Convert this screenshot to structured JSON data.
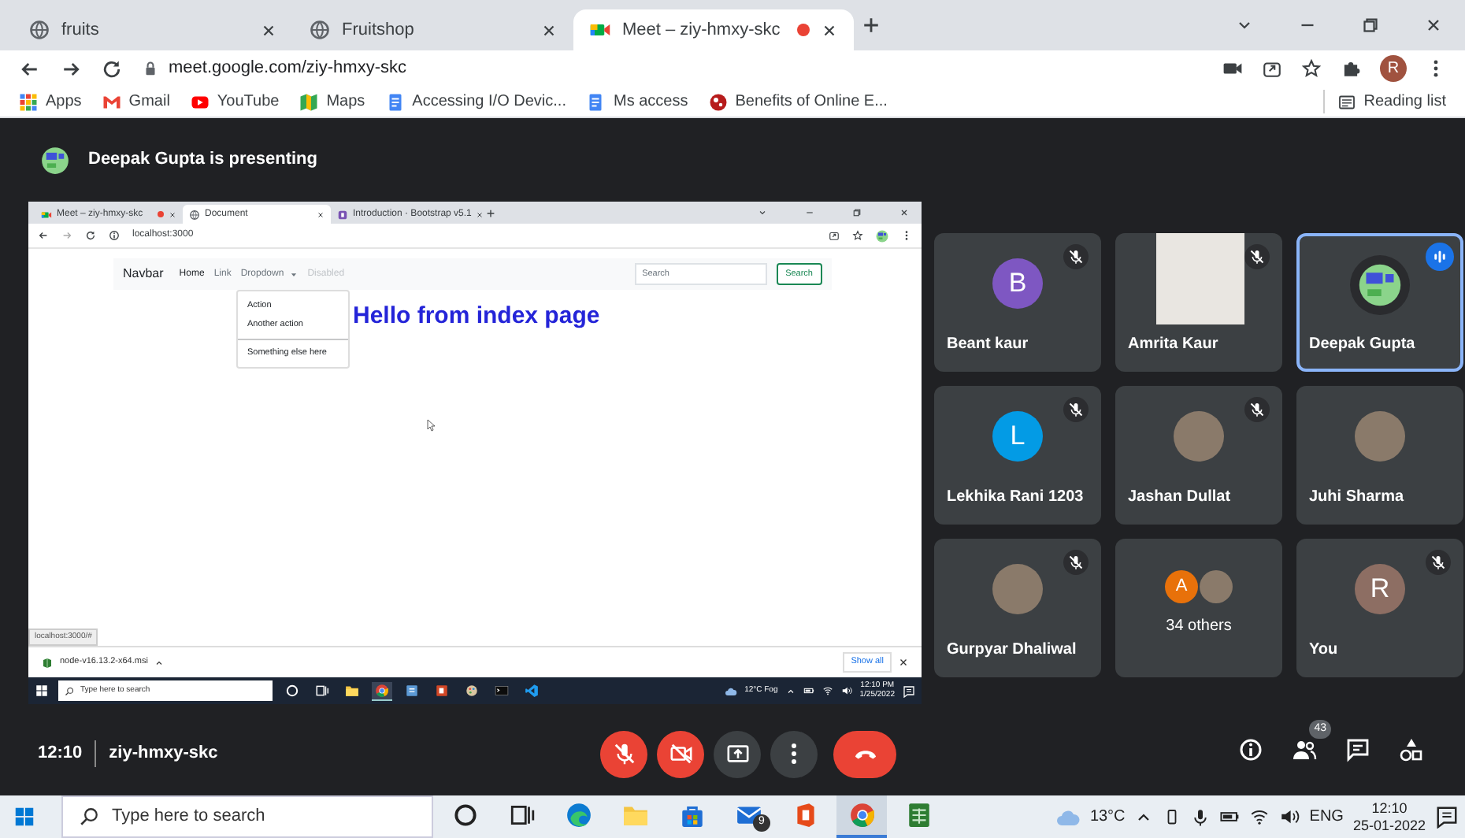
{
  "browser": {
    "tabs": [
      {
        "title": "fruits",
        "kind": "globe",
        "selected": false,
        "recording": false
      },
      {
        "title": "Fruitshop",
        "kind": "globe",
        "selected": false,
        "recording": false
      },
      {
        "title": "Meet – ziy-hmxy-skc",
        "kind": "meet",
        "selected": true,
        "recording": true
      }
    ],
    "address": "meet.google.com/ziy-hmxy-skc",
    "profile_initial": "R",
    "bookmarks": [
      {
        "label": "Apps",
        "kind": "apps"
      },
      {
        "label": "Gmail",
        "kind": "gmail"
      },
      {
        "label": "YouTube",
        "kind": "youtube"
      },
      {
        "label": "Maps",
        "kind": "maps"
      },
      {
        "label": "Accessing I/O Devic...",
        "kind": "doc"
      },
      {
        "label": "Ms access",
        "kind": "doc"
      },
      {
        "label": "Benefits of Online E...",
        "kind": "site"
      }
    ],
    "reading_list": "Reading list"
  },
  "meet": {
    "presenter_banner": "Deepak Gupta is presenting",
    "shared_screen": {
      "tabs": [
        {
          "title": "Meet – ziy-hmxy-skc",
          "kind": "meet",
          "selected": false,
          "recording": true
        },
        {
          "title": "Document",
          "kind": "globe",
          "selected": true,
          "recording": false
        },
        {
          "title": "Introduction · Bootstrap v5.1",
          "kind": "bootstrap",
          "selected": false,
          "recording": false
        }
      ],
      "address": "localhost:3000",
      "navbar": {
        "brand": "Navbar",
        "links": [
          {
            "label": "Home",
            "active": true,
            "disabled": false,
            "dropdown": false
          },
          {
            "label": "Link",
            "active": false,
            "disabled": false,
            "dropdown": false
          },
          {
            "label": "Dropdown",
            "active": false,
            "disabled": false,
            "dropdown": true
          },
          {
            "label": "Disabled",
            "active": false,
            "disabled": true,
            "dropdown": false
          }
        ],
        "search_placeholder": "Search",
        "search_button": "Search"
      },
      "dropdown_menu": [
        {
          "kind": "item",
          "label": "Action"
        },
        {
          "kind": "item",
          "label": "Another action"
        },
        {
          "kind": "divider"
        },
        {
          "kind": "item",
          "label": "Something else here"
        }
      ],
      "heading": "Hello from index page",
      "status_url": "localhost:3000/#",
      "download": {
        "file": "node-v16.13.2-x64.msi",
        "show_all": "Show all"
      },
      "taskbar": {
        "search_placeholder": "Type here to search",
        "apps": [
          {
            "kind": "cortana",
            "selected": false
          },
          {
            "kind": "taskview",
            "selected": false
          },
          {
            "kind": "folder",
            "selected": false
          },
          {
            "kind": "chrome",
            "selected": true
          },
          {
            "kind": "word",
            "selected": false
          },
          {
            "kind": "slides",
            "selected": false
          },
          {
            "kind": "paint",
            "selected": false
          },
          {
            "kind": "terminal",
            "selected": false
          },
          {
            "kind": "code",
            "selected": false
          }
        ],
        "weather": "12°C  Fog",
        "time": "12:10 PM",
        "date": "1/25/2022"
      }
    },
    "participants": [
      {
        "name": "Beant kaur",
        "kind": "initial",
        "initial": "B",
        "color": "#7e57c2",
        "muted": true,
        "speaking": false
      },
      {
        "name": "Amrita Kaur",
        "kind": "video",
        "muted": true,
        "speaking": false
      },
      {
        "name": "Deepak Gupta",
        "kind": "screen",
        "muted": false,
        "speaking": true
      },
      {
        "name": "Lekhika Rani 1203",
        "kind": "initial",
        "initial": "L",
        "color": "#039be5",
        "muted": true,
        "speaking": false
      },
      {
        "name": "Jashan Dullat",
        "kind": "photo",
        "muted": true,
        "speaking": false
      },
      {
        "name": "Juhi Sharma",
        "kind": "photo",
        "muted": false,
        "speaking": false
      },
      {
        "name": "Gurpyar Dhaliwal",
        "kind": "photo",
        "muted": true,
        "speaking": false
      },
      {
        "name": "34 others",
        "kind": "group",
        "initial": "A",
        "color": "#e8710a",
        "muted": false,
        "speaking": false
      },
      {
        "name": "You",
        "kind": "initial",
        "initial": "R",
        "color": "#8d6e63",
        "muted": true,
        "speaking": false
      }
    ],
    "meeting_time": "12:10",
    "meeting_code": "ziy-hmxy-skc",
    "controls": [
      {
        "kind": "mic",
        "on": false
      },
      {
        "kind": "camera",
        "on": false
      },
      {
        "kind": "present"
      },
      {
        "kind": "more"
      },
      {
        "kind": "hangup"
      }
    ],
    "side_buttons": [
      {
        "kind": "info"
      },
      {
        "kind": "people",
        "badge": "43"
      },
      {
        "kind": "chat"
      },
      {
        "kind": "activities"
      }
    ]
  },
  "taskbar": {
    "search_placeholder": "Type here to search",
    "apps": [
      {
        "kind": "cortana",
        "selected": false
      },
      {
        "kind": "taskview",
        "selected": false
      },
      {
        "kind": "edge",
        "selected": false
      },
      {
        "kind": "folder",
        "selected": false
      },
      {
        "kind": "store",
        "selected": false
      },
      {
        "kind": "mail",
        "selected": false,
        "badge": "9"
      },
      {
        "kind": "office",
        "selected": false
      },
      {
        "kind": "chrome",
        "selected": true
      },
      {
        "kind": "sheet",
        "selected": false
      }
    ],
    "weather": "13°C",
    "language": "ENG",
    "time": "12:10",
    "date": "25-01-2022"
  }
}
